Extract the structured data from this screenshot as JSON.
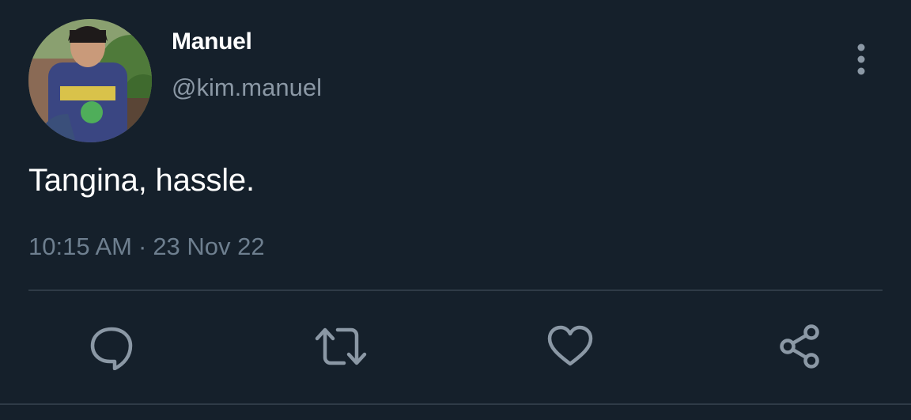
{
  "tweet": {
    "author": {
      "display_name": "Manuel",
      "handle": "@kim.manuel",
      "avatar_icon": "profile-photo"
    },
    "text": "Tangina, hassle.",
    "time": "10:15 AM",
    "separator": "·",
    "date": "23 Nov 22",
    "menu_icon": "more-vertical-icon"
  },
  "actions": [
    {
      "name": "reply",
      "icon": "speech-bubble-icon"
    },
    {
      "name": "retweet",
      "icon": "retweet-arrows-icon"
    },
    {
      "name": "like",
      "icon": "heart-icon"
    },
    {
      "name": "share",
      "icon": "share-nodes-icon"
    }
  ],
  "colors": {
    "background": "#15202b",
    "primary_text": "#ffffff",
    "secondary_text": "#8b98a5",
    "icon": "#8b98a5",
    "divider": "#2f3b47"
  }
}
